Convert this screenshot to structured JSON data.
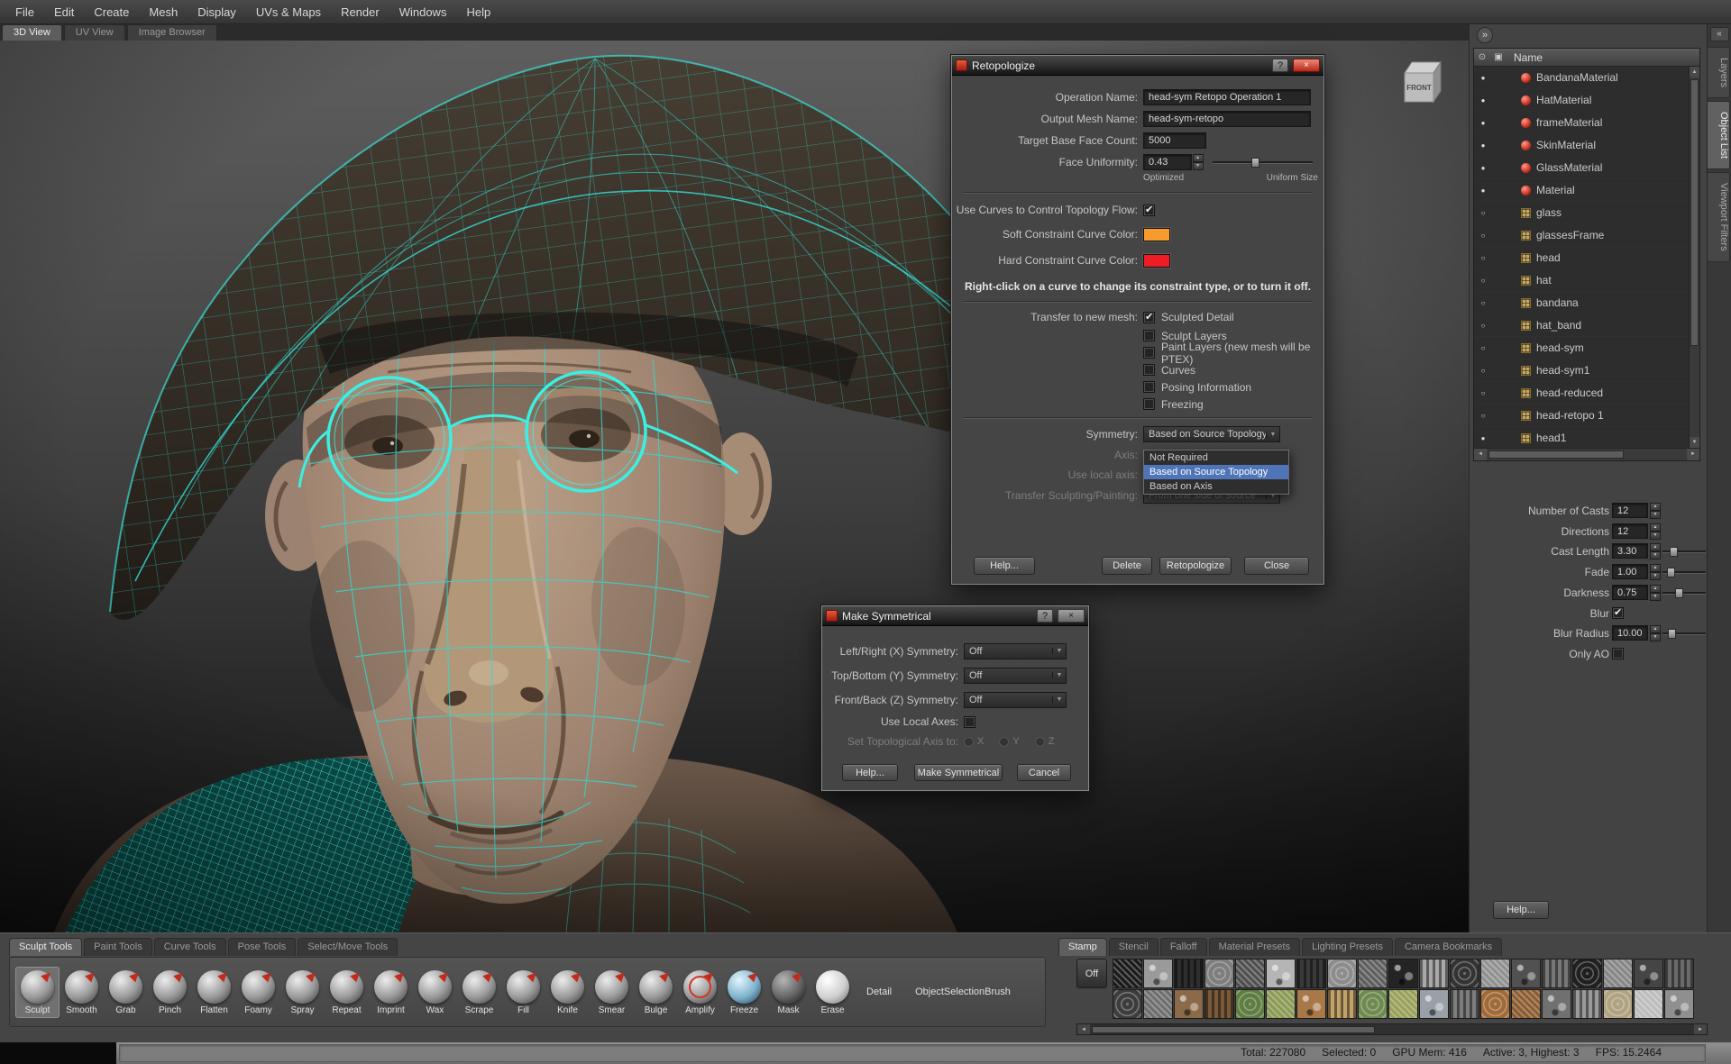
{
  "icons": {
    "close": "×",
    "help": "?",
    "chevron_down": "▼",
    "collapse_right": "»",
    "collapse_left": "«",
    "eye": "⊙",
    "box": "▣",
    "scroll_left": "◄",
    "scroll_right": "►",
    "scroll_up": "▲",
    "scroll_down": "▼",
    "dot_filled": "●",
    "dot_hollow": "○"
  },
  "menu": {
    "items": [
      "File",
      "Edit",
      "Create",
      "Mesh",
      "Display",
      "UVs & Maps",
      "Render",
      "Windows",
      "Help"
    ]
  },
  "view_tabs": [
    {
      "label": "3D View",
      "active": true
    },
    {
      "label": "UV View",
      "active": false
    },
    {
      "label": "Image Browser",
      "active": false
    }
  ],
  "viewport": {
    "gizmo": "FRONT"
  },
  "retopo": {
    "title": "Retopologize",
    "operation_name_label": "Operation Name:",
    "operation_name_value": "head-sym Retopo Operation 1",
    "output_mesh_label": "Output Mesh Name:",
    "output_mesh_value": "head-sym-retopo",
    "face_count_label": "Target Base Face Count:",
    "face_count_value": "5000",
    "uniformity_label": "Face Uniformity:",
    "uniformity_value": "0.43",
    "optimized_label": "Optimized",
    "uniform_label": "Uniform Size",
    "use_curves_label": "Use Curves to Control Topology Flow:",
    "soft_color_label": "Soft Constraint Curve Color:",
    "hard_color_label": "Hard Constraint Curve Color:",
    "soft_color": "#f79b2e",
    "hard_color": "#ee1c25",
    "rightclick_note": "Right-click on a curve to change its constraint type, or to turn it off.",
    "transfer_label": "Transfer to new mesh:",
    "transfer_first": "Sculpted Detail",
    "transfer_options": [
      "Sculpt Layers",
      "Paint Layers (new mesh will be PTEX)",
      "Curves",
      "Posing Information",
      "Freezing"
    ],
    "symmetry_label": "Symmetry:",
    "symmetry_value": "Based on Source Topology",
    "axis_label": "Axis:",
    "use_local_label": "Use local axis:",
    "transfer_sp_label": "Transfer Sculpting/Painting:",
    "transfer_sp_value": "From one side of source",
    "dropdown_options": [
      "Not Required",
      "Based on Source Topology",
      "Based on Axis"
    ],
    "dropdown_selected_index": 1,
    "buttons": {
      "help": "Help...",
      "delete": "Delete",
      "retopologize": "Retopologize",
      "close": "Close"
    }
  },
  "make_sym": {
    "title": "Make Symmetrical",
    "rows": [
      {
        "label": "Left/Right (X) Symmetry:",
        "value": "Off"
      },
      {
        "label": "Top/Bottom (Y) Symmetry:",
        "value": "Off"
      },
      {
        "label": "Front/Back (Z) Symmetry:",
        "value": "Off"
      }
    ],
    "use_local_label": "Use Local Axes:",
    "topo_axis_label": "Set Topological Axis to:",
    "axis_options": [
      "X",
      "Y",
      "Z"
    ],
    "buttons": {
      "help": "Help...",
      "make": "Make Symmetrical",
      "cancel": "Cancel"
    }
  },
  "object_list": {
    "header": "Name",
    "items": [
      {
        "label": "BandanaMaterial",
        "type": "material",
        "visible": true
      },
      {
        "label": "HatMaterial",
        "type": "material",
        "visible": true
      },
      {
        "label": "frameMaterial",
        "type": "material",
        "visible": true
      },
      {
        "label": "SkinMaterial",
        "type": "material",
        "visible": true
      },
      {
        "label": "GlassMaterial",
        "type": "material",
        "visible": true
      },
      {
        "label": "Material",
        "type": "material",
        "visible": true
      },
      {
        "label": "glass",
        "type": "mesh",
        "visible": false
      },
      {
        "label": "glassesFrame",
        "type": "mesh",
        "visible": false
      },
      {
        "label": "head",
        "type": "mesh",
        "visible": false
      },
      {
        "label": "hat",
        "type": "mesh",
        "visible": false
      },
      {
        "label": "bandana",
        "type": "mesh",
        "visible": false
      },
      {
        "label": "hat_band",
        "type": "mesh",
        "visible": false
      },
      {
        "label": "head-sym",
        "type": "mesh",
        "visible": false
      },
      {
        "label": "head-sym1",
        "type": "mesh",
        "visible": false
      },
      {
        "label": "head-reduced",
        "type": "mesh",
        "visible": false
      },
      {
        "label": "head-retopo 1",
        "type": "mesh",
        "visible": false
      },
      {
        "label": "head1",
        "type": "mesh",
        "visible": true
      }
    ]
  },
  "side_tabs": [
    {
      "label": "Layers",
      "active": false
    },
    {
      "label": "Object List",
      "active": true
    },
    {
      "label": "Viewport Filters",
      "active": false
    }
  ],
  "properties": {
    "rows": [
      {
        "label": "Number of Casts",
        "value": "12",
        "slider": false
      },
      {
        "label": "Directions",
        "value": "12",
        "slider": false
      },
      {
        "label": "Cast Length",
        "value": "3.30",
        "slider": true,
        "pos": 25
      },
      {
        "label": "Fade",
        "value": "1.00",
        "slider": true,
        "pos": 18
      },
      {
        "label": "Darkness",
        "value": "0.75",
        "slider": true,
        "pos": 38
      },
      {
        "label": "Blur",
        "checkbox": true,
        "checked": true
      },
      {
        "label": "Blur Radius",
        "value": "10.00",
        "slider": true,
        "pos": 20
      },
      {
        "label": "Only AO",
        "checkbox": true,
        "checked": false
      }
    ],
    "help_button": "Help..."
  },
  "tool_tray": {
    "tabs": [
      {
        "label": "Sculpt Tools",
        "active": true
      },
      {
        "label": "Paint Tools",
        "active": false
      },
      {
        "label": "Curve Tools",
        "active": false
      },
      {
        "label": "Pose Tools",
        "active": false
      },
      {
        "label": "Select/Move Tools",
        "active": false
      }
    ],
    "selected_tool": "Sculpt",
    "tools": [
      {
        "label": "Sculpt"
      },
      {
        "label": "Smooth"
      },
      {
        "label": "Grab"
      },
      {
        "label": "Pinch"
      },
      {
        "label": "Flatten"
      },
      {
        "label": "Foamy"
      },
      {
        "label": "Spray"
      },
      {
        "label": "Repeat"
      },
      {
        "label": "Imprint"
      },
      {
        "label": "Wax"
      },
      {
        "label": "Scrape"
      },
      {
        "label": "Fill"
      },
      {
        "label": "Knife"
      },
      {
        "label": "Smear"
      },
      {
        "label": "Bulge"
      },
      {
        "label": "Amplify",
        "variant": "ring"
      },
      {
        "label": "Freeze",
        "variant": "blue"
      },
      {
        "label": "Mask",
        "variant": "dark"
      },
      {
        "label": "Erase",
        "variant": "light"
      }
    ],
    "extra_items": [
      "Detail",
      "ObjectSelectionBrush"
    ]
  },
  "presets": {
    "tabs": [
      {
        "label": "Stamp",
        "active": true
      },
      {
        "label": "Stencil",
        "active": false
      },
      {
        "label": "Falloff",
        "active": false
      },
      {
        "label": "Material Presets",
        "active": false
      },
      {
        "label": "Lighting Presets",
        "active": false
      },
      {
        "label": "Camera Bookmarks",
        "active": false
      }
    ],
    "off_button": "Off",
    "thumb_rows": 2,
    "thumb_cols": 19,
    "row1_colors": [
      "#1a1a1a",
      "#9a9a9a",
      "#2e2e2e",
      "#7d7d7d",
      "#4f4f4f",
      "#b5b5b5",
      "#3a3a3a",
      "#8c8c8c",
      "#5e5e5e",
      "#242424",
      "#a8a8a8",
      "#333333",
      "#909090",
      "#515151",
      "#777777",
      "#1f1f1f",
      "#868686",
      "#454545",
      "#6a6a6a"
    ],
    "row2_colors": [
      "#3c3c3c",
      "#6e6e6e",
      "#8a6a48",
      "#7a5a3a",
      "#5f7d42",
      "#8a9a55",
      "#a87848",
      "#c2a269",
      "#6f8a4f",
      "#98a058",
      "#9aa0a8",
      "#7d7d7d",
      "#a06a38",
      "#8a5c30",
      "#707070",
      "#9a9a9a",
      "#b0a382",
      "#bcbcbc",
      "#8f8f8f"
    ]
  },
  "status_bar": {
    "segments": [
      "Total: 227080",
      "Selected: 0",
      "GPU Mem: 416",
      "Active: 3, Highest: 3",
      "FPS: 15.2464"
    ]
  }
}
